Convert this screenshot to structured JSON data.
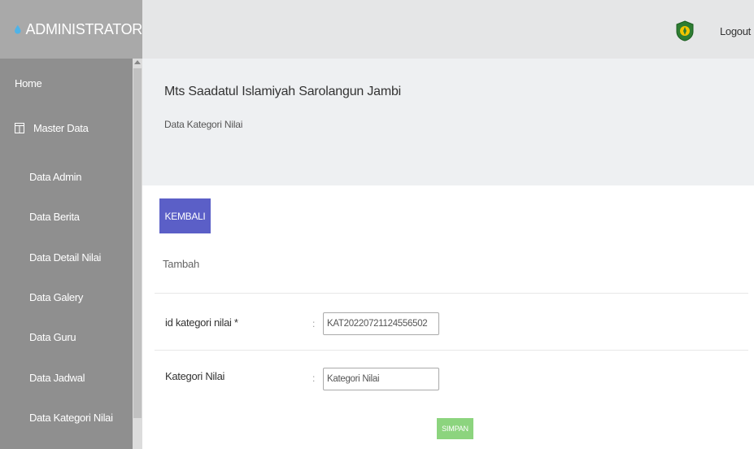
{
  "sidebar": {
    "brand": "ADMINISTRATOR",
    "home": "Home",
    "master_data": "Master Data",
    "items": [
      {
        "label": "Data Admin"
      },
      {
        "label": "Data Berita"
      },
      {
        "label": "Data Detail Nilai"
      },
      {
        "label": "Data Galery"
      },
      {
        "label": "Data Guru"
      },
      {
        "label": "Data Jadwal"
      },
      {
        "label": "Data Kategori Nilai"
      }
    ]
  },
  "topbar": {
    "logout": "Logout",
    "logo_icon": "school-logo-icon"
  },
  "header": {
    "title": "Mts Saadatul Islamiyah Sarolangun Jambi",
    "subtitle": "Data Kategori Nilai"
  },
  "main": {
    "back_button": "KEMBALI",
    "section_label": "Tambah",
    "fields": [
      {
        "label": "id kategori nilai *",
        "colon": ":",
        "value": "KAT20220721124556502",
        "placeholder": ""
      },
      {
        "label": "Kategori Nilai",
        "colon": ":",
        "value": "",
        "placeholder": "Kategori Nilai"
      }
    ],
    "save_button": "SIMPAN"
  },
  "colors": {
    "sidebar_bg": "#8f8f8f",
    "brand_bg": "#a9a9a9",
    "back_button": "#5b5fc7",
    "save_button": "#8cd47e"
  }
}
